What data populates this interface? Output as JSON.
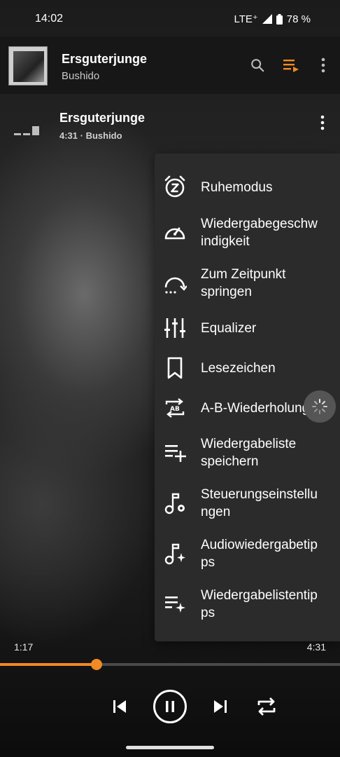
{
  "status_bar": {
    "time": "14:02",
    "network": "LTE⁺",
    "battery": "78 %"
  },
  "header": {
    "title": "Ersguterjunge",
    "artist": "Bushido"
  },
  "track": {
    "title": "Ersguterjunge",
    "meta": "4:31 · Bushido"
  },
  "menu": {
    "items": [
      {
        "label": "Ruhemodus",
        "icon": "sleep-timer-icon"
      },
      {
        "label": "Wiedergabegeschw\nindigkeit",
        "icon": "speedometer-icon"
      },
      {
        "label": "Zum Zeitpunkt\nspringen",
        "icon": "jump-to-time-icon"
      },
      {
        "label": "Equalizer",
        "icon": "equalizer-icon"
      },
      {
        "label": "Lesezeichen",
        "icon": "bookmark-icon"
      },
      {
        "label": "A-B-Wiederholung",
        "icon": "ab-repeat-icon"
      },
      {
        "label": "Wiedergabeliste\nspeichern",
        "icon": "playlist-add-icon"
      },
      {
        "label": "Steuerungseinstellu\nngen",
        "icon": "music-settings-icon"
      },
      {
        "label": "Audiowiedergabetip\nps",
        "icon": "music-tips-icon"
      },
      {
        "label": "Wiedergabelistentip\nps",
        "icon": "playlist-tips-icon"
      }
    ]
  },
  "player": {
    "current_time": "1:17",
    "total_time": "4:31",
    "progress": 0.284
  },
  "colors": {
    "accent": "#f08a24",
    "menu_bg": "#2b2b2b"
  }
}
